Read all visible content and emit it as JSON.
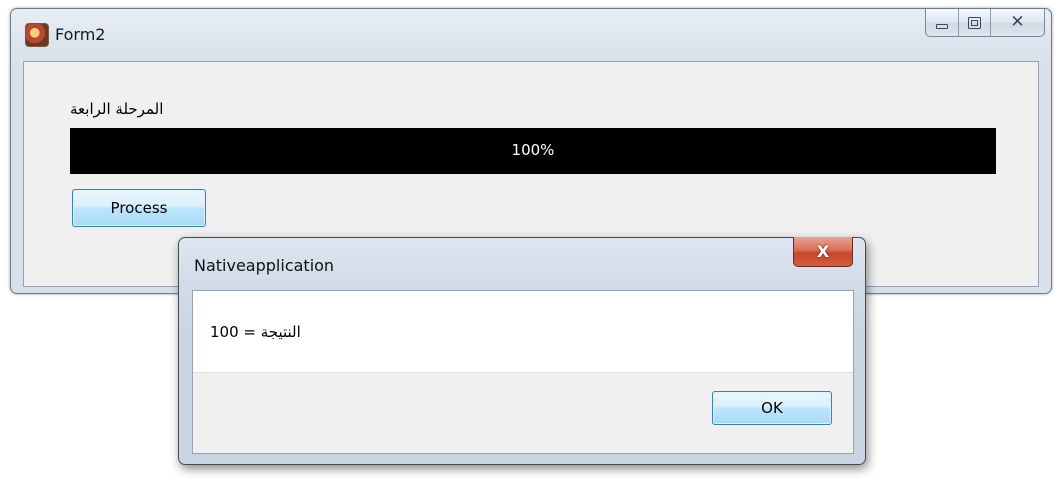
{
  "main_window": {
    "title": "Form2",
    "icon": "app-icon",
    "caption_buttons": [
      {
        "name": "minimize-icon",
        "glyph": "minimize"
      },
      {
        "name": "maximize-icon",
        "glyph": "maximize"
      },
      {
        "name": "close-icon",
        "glyph": "✕"
      }
    ],
    "stage_label": "المرحلة الرابعة",
    "progress": {
      "value_percent": 100,
      "text": "100%",
      "bar_color": "#000000",
      "text_color": "#ffffff"
    },
    "process_button_label": "Process"
  },
  "dialog": {
    "title": "Nativeapplication",
    "close_glyph": "X",
    "close_color": "#c7462b",
    "message": "النتيجة = 100",
    "ok_button_label": "OK"
  }
}
